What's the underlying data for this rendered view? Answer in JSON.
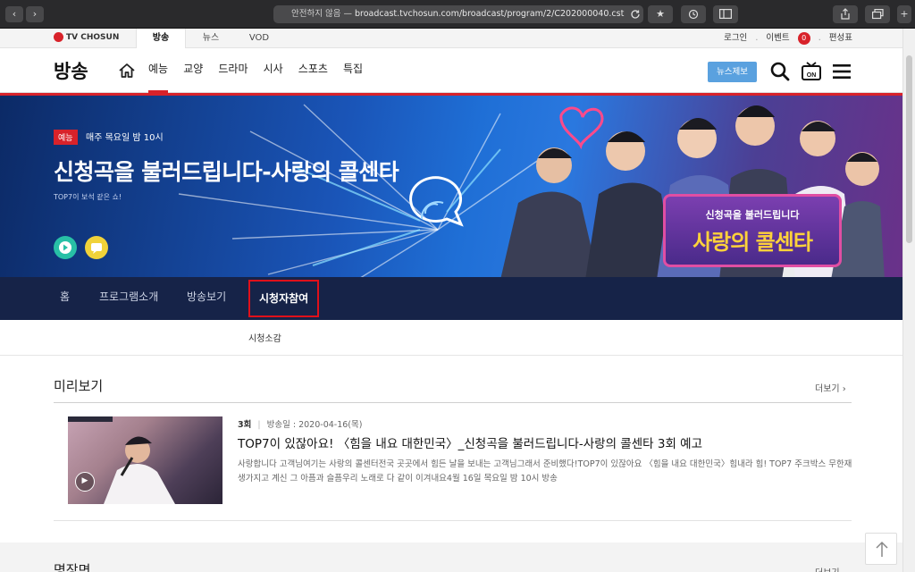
{
  "browser": {
    "back": "‹",
    "forward": "›",
    "url_insecure": "안전하지 않음 —",
    "url_text": "broadcast.tvchosun.com/broadcast/program/2/C202000040.cst"
  },
  "top_strip": {
    "brand": "TV CHOSUN",
    "tabs": [
      "방송",
      "뉴스",
      "VOD"
    ],
    "login": "로그인",
    "event": "이벤트",
    "event_count": "0",
    "schedule": "편성표"
  },
  "header": {
    "logo": "방송",
    "nav": [
      "예능",
      "교양",
      "드라마",
      "시사",
      "스포츠",
      "특집"
    ],
    "news_tip": "뉴스제보"
  },
  "hero": {
    "genre": "예능",
    "schedule": "매주 목요일 밤 10시",
    "title": "신청곡을 불러드립니다-사랑의 콜센타",
    "subtitle": "TOP7이 보석 같은 쇼!",
    "logo_line1": "신청곡을 불러드립니다",
    "logo_line2": "사랑의 콜센타"
  },
  "sub_nav": {
    "items": [
      "홈",
      "프로그램소개",
      "방송보기",
      "시청자참여"
    ],
    "sub_item": "시청소감"
  },
  "preview": {
    "title": "미리보기",
    "more": "더보기",
    "episode": "3회",
    "air_date": "방송일 : 2020-04-16(목)",
    "ep_title": "TOP7이 있잖아요! 〈힘을 내요 대한민국〉_신청곡을 불러드립니다-사랑의 콜센타 3회 예고",
    "ep_desc": "사랑합니다 고객님여기는 사랑의 콜센터전국 곳곳에서 힘든 날을 보내는 고객님그래서 준비했다!TOP7이 있잖아요 〈힘을 내요 대한민국〉힘내라 힘! TOP7 주크박스 무한재생가지고 계신 그 아픔과 슬픔우리 노래로 다 같이 이겨내요4월 16일 목요일 밤 10시 방송"
  },
  "section2": {
    "title": "명장면",
    "more": "더보기"
  },
  "colors": {
    "accent_red": "#d8222a",
    "sub_nav_bg": "#162348",
    "news_tip_blue": "#5aa1df"
  }
}
